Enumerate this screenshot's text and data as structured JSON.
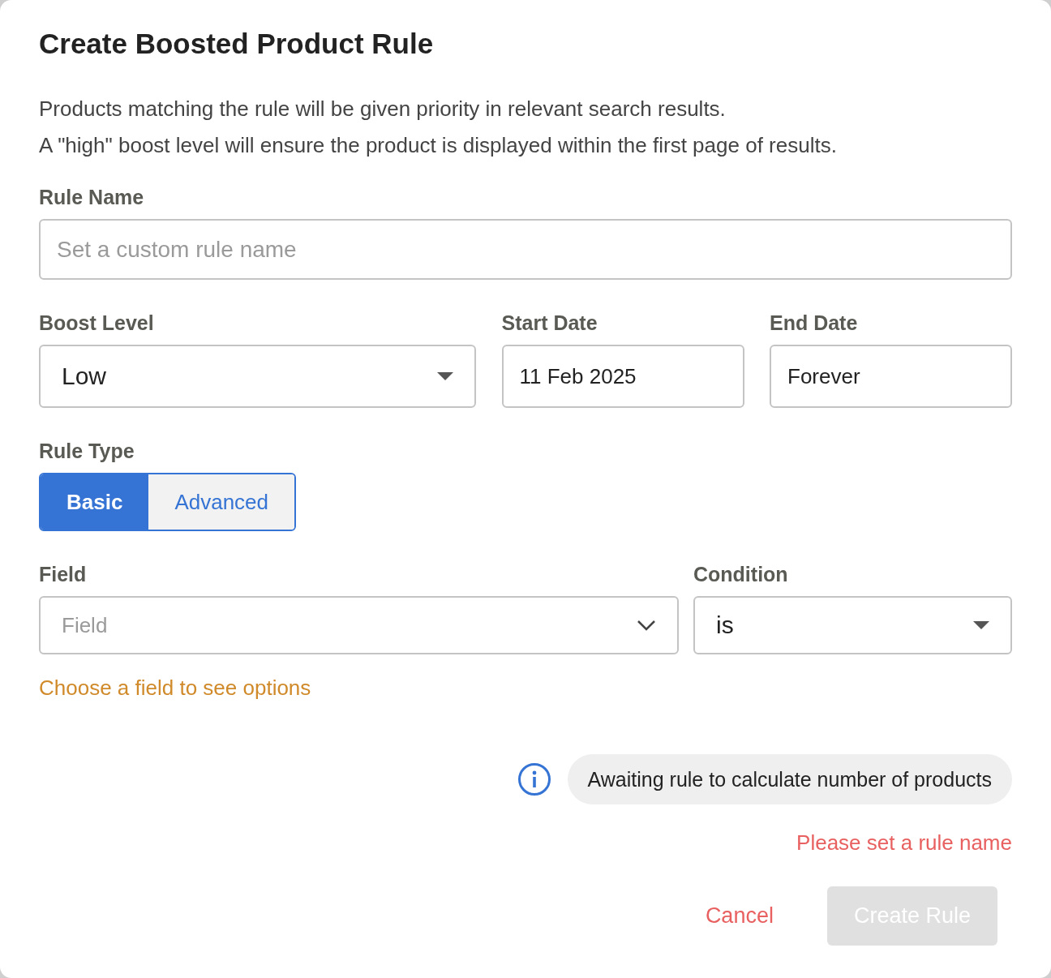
{
  "dialog": {
    "title": "Create Boosted Product Rule",
    "description": [
      "Products matching the rule will be given priority in relevant search results.",
      "A \"high\" boost level will ensure the product is displayed within the first page of results."
    ],
    "rule_name": {
      "label": "Rule Name",
      "placeholder": "Set a custom rule name"
    },
    "boost_level": {
      "label": "Boost Level",
      "value": "Low"
    },
    "start_date": {
      "label": "Start Date",
      "value": "11 Feb 2025"
    },
    "end_date": {
      "label": "End Date",
      "value": "Forever"
    },
    "rule_type": {
      "label": "Rule Type",
      "options": [
        {
          "label": "Basic",
          "selected": true
        },
        {
          "label": "Advanced",
          "selected": false
        }
      ]
    },
    "field": {
      "label": "Field",
      "placeholder": "Field"
    },
    "condition": {
      "label": "Condition",
      "value": "is"
    },
    "field_hint": "Choose a field to see options",
    "info": "Awaiting rule to calculate number of products",
    "error": "Please set a rule name",
    "cancel": "Cancel",
    "submit": {
      "label": "Create Rule",
      "disabled": true
    }
  }
}
